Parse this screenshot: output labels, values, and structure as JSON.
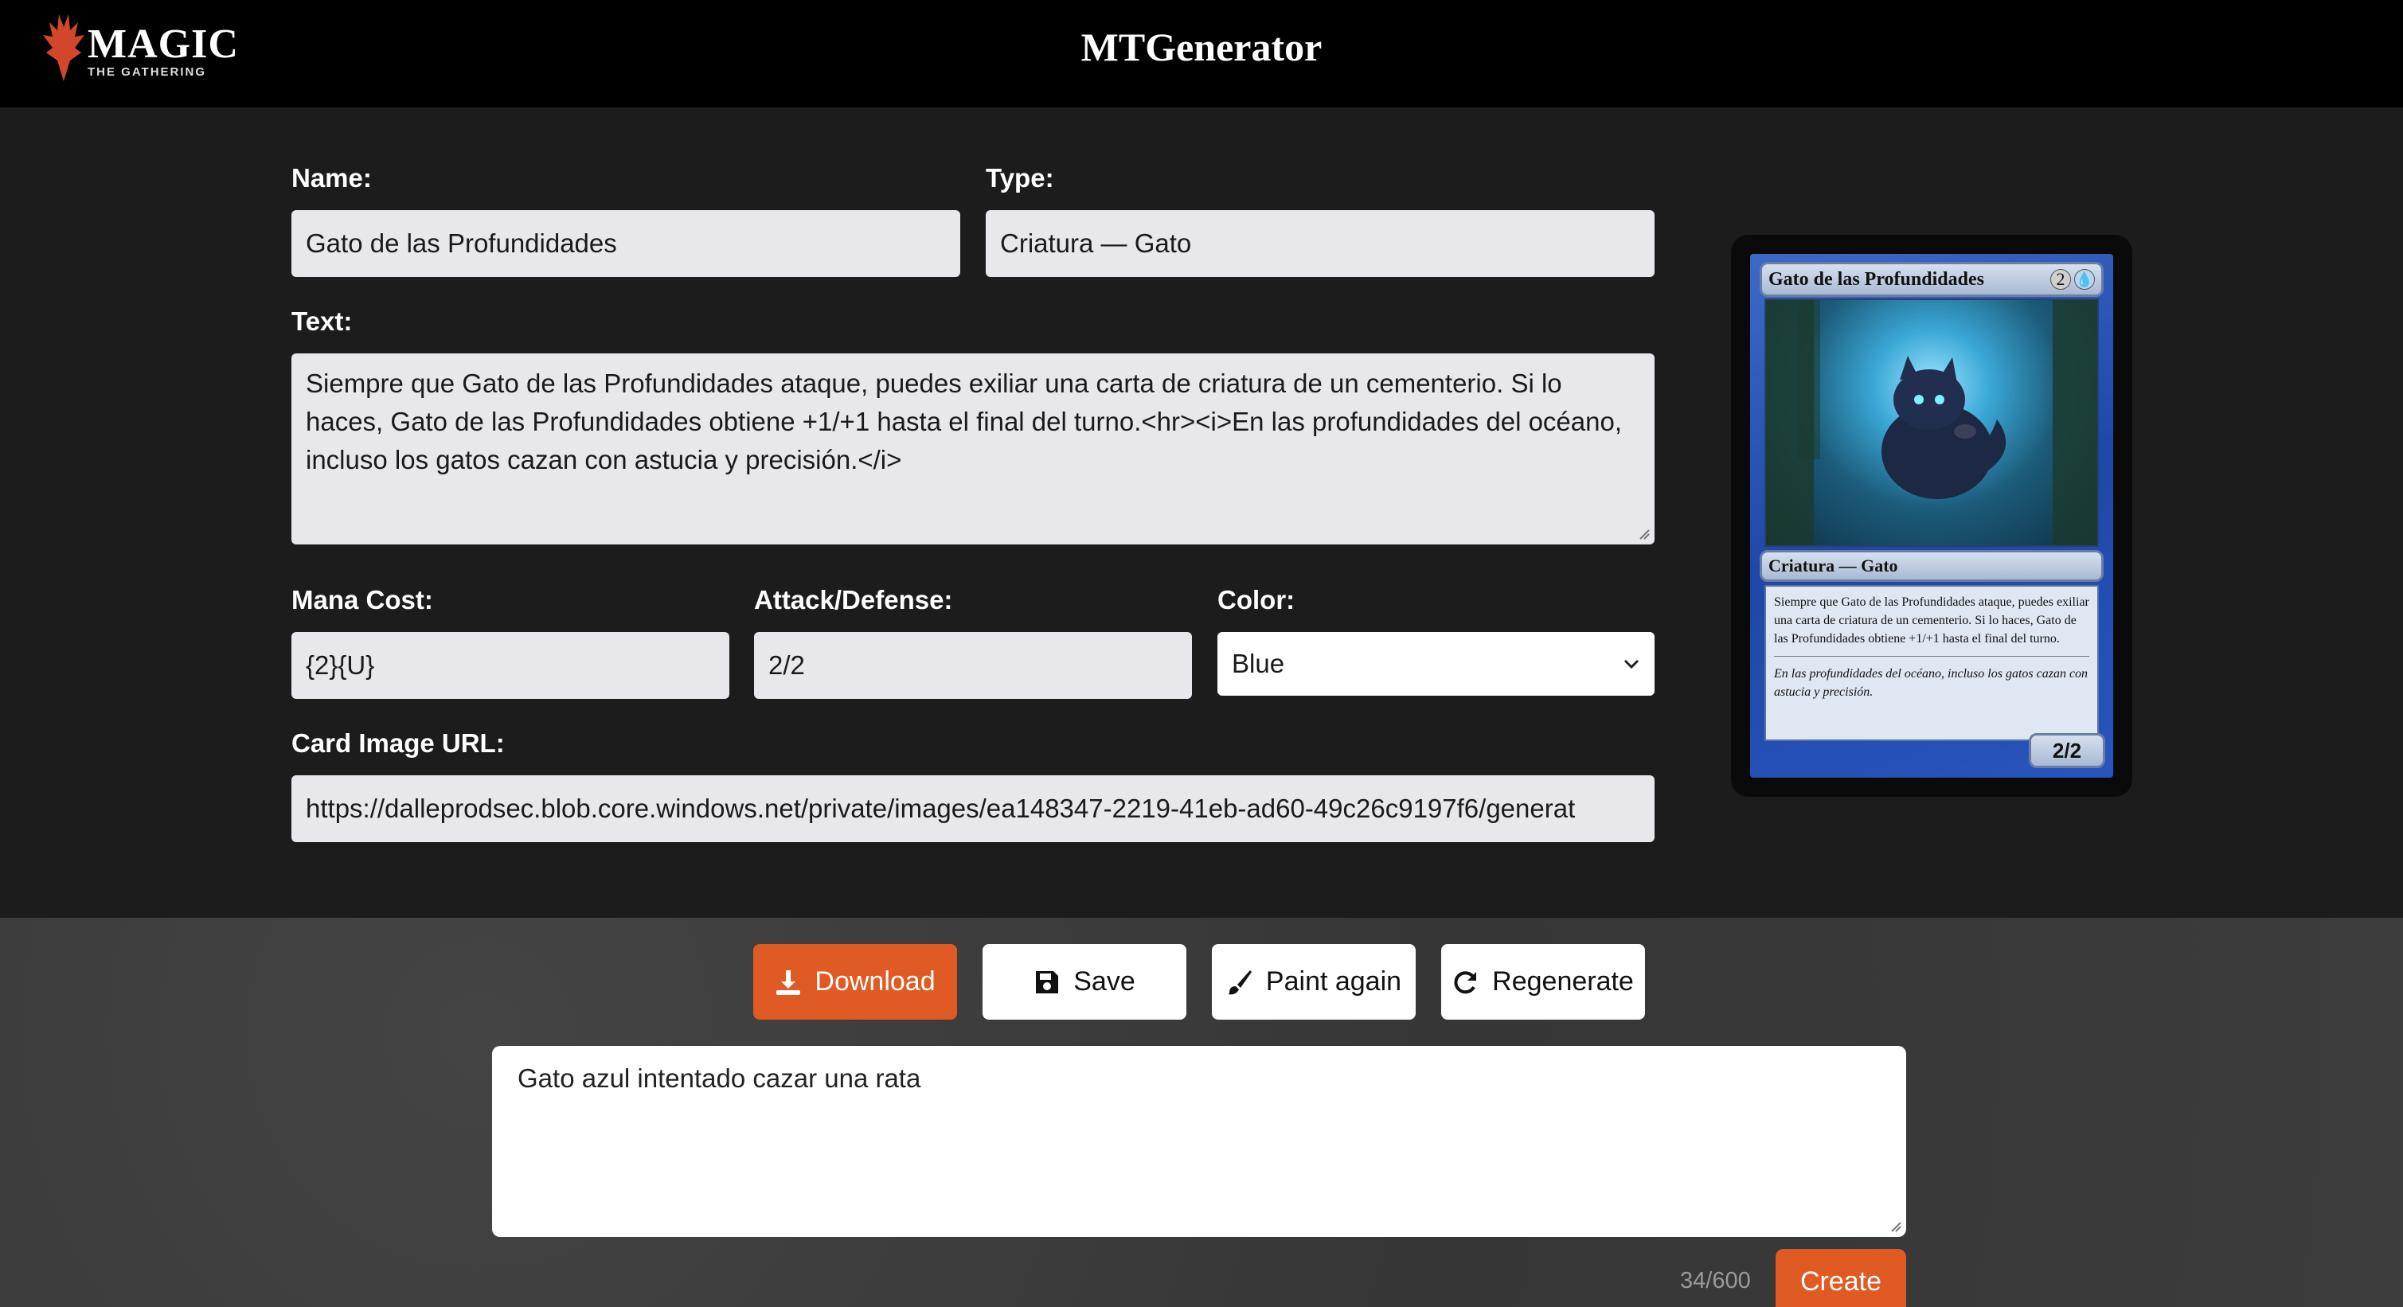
{
  "header": {
    "logo_word": "MAGIC",
    "logo_sub": "THE GATHERING",
    "title": "MTGenerator"
  },
  "form": {
    "name_label": "Name:",
    "name_value": "Gato de las Profundidades",
    "type_label": "Type:",
    "type_value": "Criatura — Gato",
    "text_label": "Text:",
    "text_value": "Siempre que Gato de las Profundidades ataque, puedes exiliar una carta de criatura de un cementerio. Si lo haces, Gato de las Profundidades obtiene +1/+1 hasta el final del turno.<hr><i>En las profundidades del océano, incluso los gatos cazan con astucia y precisión.</i>",
    "mana_label": "Mana Cost:",
    "mana_value": "{2}{U}",
    "attack_label": "Attack/Defense:",
    "attack_value": "2/2",
    "color_label": "Color:",
    "color_value": "Blue",
    "image_label": "Card Image URL:",
    "image_value": "https://dalleprodsec.blob.core.windows.net/private/images/ea148347-2219-41eb-ad60-49c26c9197f6/generat"
  },
  "card": {
    "name": "Gato de las Profundidades",
    "mana_generic": "2",
    "mana_blue_symbol": "💧",
    "type_line": "Criatura — Gato",
    "rules_text": "Siempre que Gato de las Profundidades ataque, puedes exiliar una carta de criatura de un cementerio. Si lo haces, Gato de las Profundidades obtiene +1/+1 hasta el final del turno.",
    "flavor_text": "En las profundidades del océano, incluso los gatos cazan con astucia y precisión.",
    "power_toughness": "2/2"
  },
  "actions": {
    "download": "Download",
    "save": "Save",
    "paint_again": "Paint again",
    "regenerate": "Regenerate"
  },
  "prompt": {
    "value": "Gato azul intentado cazar una rata",
    "char_count": "34/600",
    "create": "Create"
  },
  "colors": {
    "accent": "#e05a24",
    "header_bg": "#000000",
    "form_bg": "#1c1c1c",
    "field_bg": "#e8e8ec",
    "card_blue": "#2855bd"
  },
  "icons": [
    "flame-logo-icon",
    "download-icon",
    "save-icon",
    "brush-icon",
    "refresh-icon",
    "chevron-down-icon"
  ]
}
